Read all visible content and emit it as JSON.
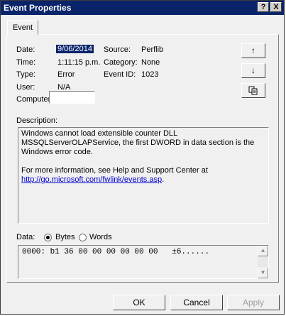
{
  "window": {
    "title": "Event Properties",
    "help_btn": "?",
    "close_btn": "X"
  },
  "tab": {
    "label": "Event"
  },
  "fields": {
    "date_label": "Date:",
    "date_value": "9/06/2014",
    "source_label": "Source:",
    "source_value": "Perflib",
    "time_label": "Time:",
    "time_value": "1:11:15 p.m.",
    "category_label": "Category:",
    "category_value": "None",
    "type_label": "Type:",
    "type_value": "Error",
    "eventid_label": "Event ID:",
    "eventid_value": "1023",
    "user_label": "User:",
    "user_value": "N/A",
    "computer_label": "Computer:",
    "computer_value": ""
  },
  "description": {
    "label": "Description:",
    "line1": "Windows cannot load extensible counter DLL",
    "line2": "MSSQLServerOLAPService, the first DWORD in data section is the",
    "line3": "Windows error code.",
    "line4": "For more information, see Help and Support Center at",
    "link": "http://go.microsoft.com/fwlink/events.asp",
    "link_suffix": "."
  },
  "data": {
    "label": "Data:",
    "bytes_label": "Bytes",
    "words_label": "Words",
    "selected": "Bytes",
    "hex_line": "0000: b1 36 00 00 00 00 00 00   ±6......"
  },
  "buttons": {
    "up": "↑",
    "down": "↓",
    "copy": "copy",
    "ok": "OK",
    "cancel": "Cancel",
    "apply": "Apply"
  }
}
